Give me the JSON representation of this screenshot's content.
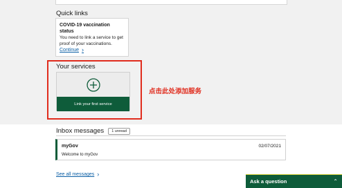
{
  "quick_links": {
    "heading": "Quick links",
    "card": {
      "title": "COVID-19 vaccination status",
      "description": "You need to link a service to get proof of your vaccinations.",
      "link_label": "Continue"
    }
  },
  "your_services": {
    "heading": "Your services",
    "add_button_label": "Link your first service",
    "icon": "plus-circle-icon"
  },
  "annotation": {
    "text": "点击此处添加服务",
    "color": "#e02b1c"
  },
  "inbox": {
    "heading": "Inbox messages",
    "unread_badge": "1 unread",
    "messages": [
      {
        "sender": "myGov",
        "date": "02/07/2021",
        "subject": "Welcome to myGov"
      }
    ],
    "see_all_label": "See all messages"
  },
  "help": {
    "ask_label": "Ask a question",
    "icon": "chevron-up-icon"
  },
  "colors": {
    "brand_green": "#0e5c3a",
    "link_blue": "#0b5fa5",
    "accent_yellow": "#d8d23a"
  }
}
